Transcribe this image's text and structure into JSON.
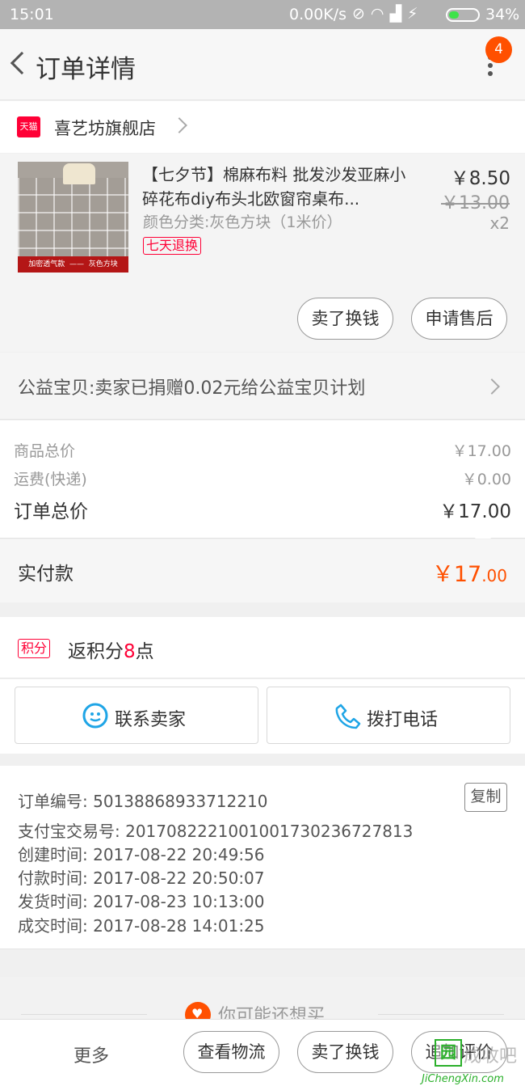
{
  "status_bar": {
    "time": "15:01",
    "speed": "0.00K/s",
    "battery": "34%",
    "battery_level": 0.34,
    "battery_color": "#3ee34a"
  },
  "header": {
    "title": "订单详情",
    "notification_count": "4"
  },
  "shop": {
    "badge": "天猫",
    "name": "喜艺坊旗舰店"
  },
  "product": {
    "title": "【七夕节】棉麻布料 批发沙发亚麻小碎花布diy布头北欧窗帘桌布...",
    "variant": "颜色分类:灰色方块（1米价）",
    "tag": "七天退换",
    "price": "￥8.50",
    "original_price": "￥13.00",
    "quantity": "x2",
    "thumbnail_caption": "加密透气款  ——  灰色方块",
    "actions": {
      "resell": "卖了换钱",
      "after_sales": "申请售后"
    }
  },
  "charity": {
    "text": "公益宝贝:卖家已捐赠0.02元给公益宝贝计划"
  },
  "summary": {
    "goods_label": "商品总价",
    "goods_value": "￥17.00",
    "shipping_label": "运费(快递)",
    "shipping_value": "￥0.00",
    "total_label": "订单总价",
    "total_value": "￥17.00"
  },
  "payment": {
    "label": "实付款",
    "currency": "￥",
    "integer": "17",
    "decimal": ".00",
    "color": "#ff5000"
  },
  "points": {
    "badge": "积分",
    "prefix": "返积分",
    "value": "8",
    "suffix": "点"
  },
  "contact": {
    "seller_label": "联系卖家",
    "call_label": "拨打电话"
  },
  "order_info": {
    "copy_label": "复制",
    "rows": [
      "订单编号: 50138868933712210",
      "支付宝交易号: 2017082221001001730236727813",
      "创建时间: 2017-08-22 20:49:56",
      "付款时间: 2017-08-22 20:50:07",
      "发货时间: 2017-08-23 10:13:00",
      "成交时间: 2017-08-28 14:01:25"
    ]
  },
  "recommend": {
    "title": "你可能还想买"
  },
  "bottom_bar": {
    "more": "更多",
    "logistics": "查看物流",
    "resell": "卖了换钱",
    "review": "追加评价"
  },
  "watermark": {
    "logo": "园",
    "text": "成收吧",
    "url": "JiChengXin.com"
  }
}
